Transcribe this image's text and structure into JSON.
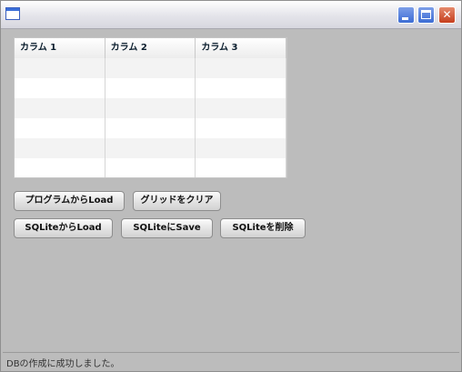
{
  "window": {
    "title": "",
    "controls": {
      "minimize": "_",
      "maximize": "□",
      "close": "✕"
    }
  },
  "grid": {
    "columns": [
      "カラム 1",
      "カラム 2",
      "カラム 3"
    ],
    "rows": []
  },
  "buttons": {
    "load_program": "プログラムからLoad",
    "clear_grid": "グリッドをクリア",
    "load_sqlite": "SQLiteからLoad",
    "save_sqlite": "SQLiteにSave",
    "delete_sqlite": "SQLiteを削除"
  },
  "status": {
    "message": "DBの作成に成功しました。"
  },
  "colors": {
    "window_background": "#bcbcbc",
    "close_button": "#c53e1e",
    "title_buttons": "#3c6cd4"
  }
}
